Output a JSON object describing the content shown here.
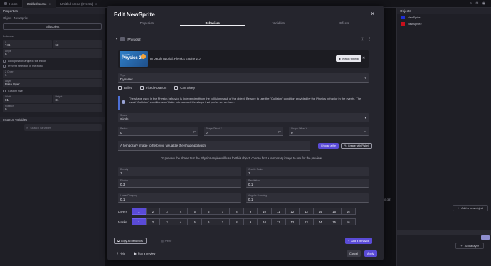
{
  "tabs": [
    {
      "label": "Home",
      "active": false
    },
    {
      "label": "Untitled scene",
      "active": true
    },
    {
      "label": "Untitled scene (Events)",
      "active": false
    }
  ],
  "left_panel": {
    "title": "Properties",
    "object_label": "Object - NewSprite",
    "edit_object": "Edit object",
    "instance_section": "Instance",
    "x_label": "X",
    "x_value": "249",
    "y_label": "Y",
    "y_value": "58",
    "angle_label": "Angle",
    "angle_value": "0",
    "lock_label": "Lock position/angle in the editor",
    "prevent_label": "Prevent selection in the editor",
    "zorder_label": "Z Order",
    "zorder_value": "1",
    "layer_label": "Layer",
    "layer_value": "Base layer",
    "custom_size_label": "Custom size",
    "width_label": "Width",
    "width_value": "81",
    "height_label": "Height",
    "height_value": "81",
    "rotation_label": "Rotation",
    "rotation_value": "0",
    "instance_vars": "Instance Variables",
    "search_placeholder": "Search variables"
  },
  "right_panel": {
    "title": "Objects",
    "items": [
      {
        "name": "NewSprite",
        "color": "#1f2fd6"
      },
      {
        "name": "NewSprite2",
        "color": "#c8101c"
      }
    ],
    "add_object": "Add a new object",
    "add_layer": "Add a layer",
    "coordinates": "(55;38)"
  },
  "dialog": {
    "title": "Edit NewSprite",
    "tabs": [
      {
        "label": "Properties",
        "active": false
      },
      {
        "label": "Behaviors",
        "active": true
      },
      {
        "label": "Variables",
        "active": false
      },
      {
        "label": "Effects",
        "active": false
      }
    ],
    "behavior_name": "Physics2",
    "tutorial": {
      "thumb_small": "In depth",
      "thumb_big": "Physics 2.0",
      "text": "In Depth Tutorial: Physics Engine 2.0",
      "button": "Watch tutorial"
    },
    "type": {
      "label": "Type",
      "value": "Dynamic"
    },
    "checks": [
      "Bullet",
      "Fixed Rotation",
      "Can Sleep"
    ],
    "info": "The shape used in the Physics behavior is independent from the collision mask of the object. Be sure to use the \"Collision\" condition provided by the Physics behavior in the events. The usual \"Collision\" condition won't take into account the shape that you've set up here.",
    "shape": {
      "label": "Shape",
      "value": "Circle"
    },
    "radius": {
      "label": "Radius",
      "value": "0",
      "unit": "px"
    },
    "offset_x": {
      "label": "Shape Offset X",
      "value": "0",
      "unit": "px"
    },
    "offset_y": {
      "label": "Shape Offset Y",
      "value": "0",
      "unit": "px"
    },
    "temp_image_placeholder": "A temporary image to help you visualize the shape/polygon",
    "choose_file": "Choose a file",
    "create_piskel": "Create with Piskel",
    "preview_note": "To preview the shape that the Physics engine will use for this object, choose first a temporary image to use for the preview.",
    "density": {
      "label": "Density",
      "value": "1"
    },
    "gravity_scale": {
      "label": "Gravity Scale",
      "value": "1"
    },
    "friction": {
      "label": "Friction",
      "value": "0.3"
    },
    "restitution": {
      "label": "Restitution",
      "value": "0.1"
    },
    "linear_damping": {
      "label": "Linear Damping",
      "value": "0.1"
    },
    "angular_damping": {
      "label": "Angular Damping",
      "value": "0.1"
    },
    "layers_label": "Layers",
    "masks_label": "Masks",
    "layer_numbers": [
      "1",
      "2",
      "3",
      "4",
      "5",
      "6",
      "7",
      "8",
      "9",
      "10",
      "11",
      "12",
      "13",
      "14",
      "15",
      "16"
    ],
    "layers_active": 1,
    "masks_active": 1,
    "copy_all": "Copy all behaviors",
    "paste": "Paste",
    "add_behavior": "Add a behavior",
    "help": "Help",
    "run_preview": "Run a preview",
    "cancel": "Cancel",
    "apply": "Apply"
  }
}
